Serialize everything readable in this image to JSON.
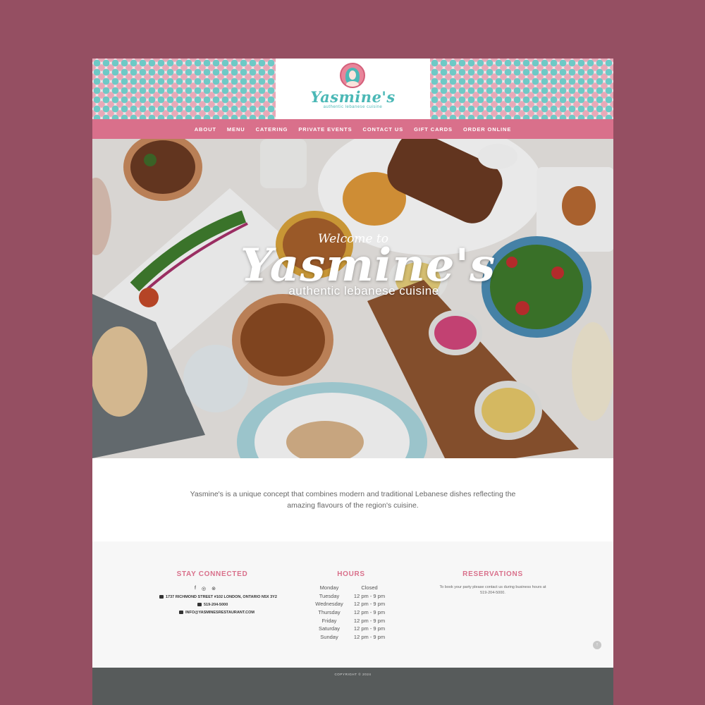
{
  "logo": {
    "name": "Yasmine's",
    "tagline": "authentic lebanese cuisine"
  },
  "nav": [
    "ABOUT",
    "MENU",
    "CATERING",
    "PRIVATE EVENTS",
    "CONTACT US",
    "GIFT CARDS",
    "ORDER ONLINE"
  ],
  "hero": {
    "welcome": "Welcome to",
    "title": "Yasmine's",
    "subtitle": "authentic lebanese cuisine"
  },
  "intro": "Yasmine's is a unique concept that combines modern and traditional Lebanese dishes reflecting the amazing flavours of the region's cuisine.",
  "stay_connected": {
    "title": "STAY CONNECTED",
    "social_icons": [
      "facebook-icon",
      "instagram-icon",
      "tripadvisor-icon"
    ],
    "address": "1737 RICHMOND STREET #102 LONDON, ONTARIO N5X 3Y2",
    "phone": "519-204-5000",
    "email": "INFO@YASMINESRESTAURANT.COM"
  },
  "hours": {
    "title": "HOURS",
    "rows": [
      {
        "day": "Monday",
        "time": "Closed"
      },
      {
        "day": "Tuesday",
        "time": "12 pm - 9 pm"
      },
      {
        "day": "Wednesday",
        "time": "12 pm - 9 pm"
      },
      {
        "day": "Thursday",
        "time": "12 pm - 9 pm"
      },
      {
        "day": "Friday",
        "time": "12 pm - 9 pm"
      },
      {
        "day": "Saturday",
        "time": "12 pm - 9 pm"
      },
      {
        "day": "Sunday",
        "time": "12 pm - 9 pm"
      }
    ]
  },
  "reservations": {
    "title": "RESERVATIONS",
    "text": "To book your party please contact us during business hours at 519-204-5000."
  },
  "scroll_top": "↑",
  "copyright": "COPYRIGHT © 2024",
  "colors": {
    "background": "#954f62",
    "nav_pink": "#d9708b",
    "teal": "#4bb8b6",
    "footer_dark": "#575b5b"
  }
}
